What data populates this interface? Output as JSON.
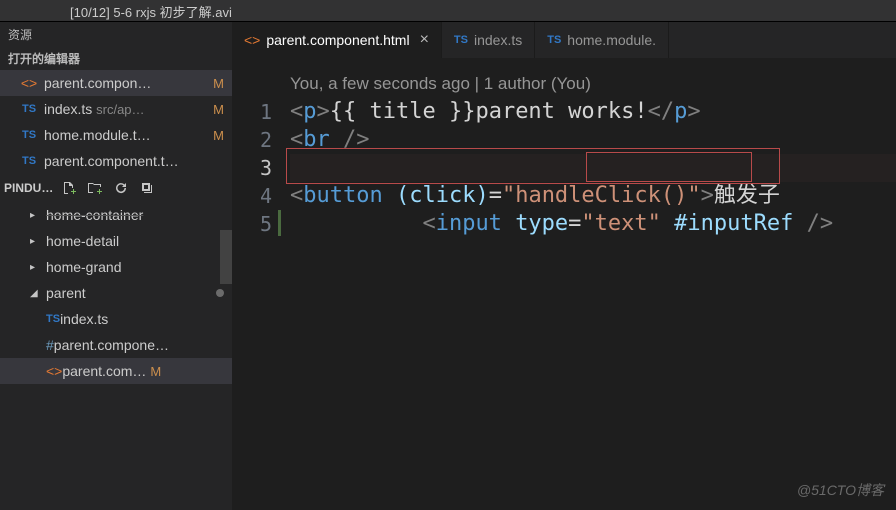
{
  "title": "[10/12] 5-6 rxjs 初步了解.avi",
  "sidebar": {
    "resources_label": "资源",
    "open_editors_label": "打开的编辑器",
    "editors": [
      {
        "icon": "<>",
        "iconClass": "orange",
        "name": "parent.compon…",
        "git": "M",
        "selected": true
      },
      {
        "icon": "TS",
        "iconClass": "ts",
        "name": "index.ts",
        "suffix": "src/ap…",
        "git": "M"
      },
      {
        "icon": "TS",
        "iconClass": "ts",
        "name": "home.module.t…",
        "git": "M"
      },
      {
        "icon": "TS",
        "iconClass": "ts",
        "name": "parent.component.t…"
      }
    ],
    "folder_label": "PINDU…",
    "tree": [
      {
        "label": "home-container",
        "expand": "▸",
        "strike": true
      },
      {
        "label": "home-detail",
        "expand": "▸"
      },
      {
        "label": "home-grand",
        "expand": "▸"
      },
      {
        "label": "parent",
        "expand": "◢",
        "dot": true,
        "open": true
      },
      {
        "icon": "TS",
        "iconClass": "ts",
        "label": "index.ts",
        "depth2": true
      },
      {
        "icon": "#",
        "iconClass": "hash",
        "label": "parent.compone…",
        "depth2": true
      },
      {
        "icon": "<>",
        "iconClass": "orange",
        "label": "parent.com…",
        "depth2": true,
        "git": "M",
        "selected": true
      }
    ]
  },
  "tabs": [
    {
      "icon": "<>",
      "iconClass": "orange",
      "label": "parent.component.html",
      "active": true,
      "closable": true
    },
    {
      "icon": "TS",
      "iconClass": "ts",
      "label": "index.ts"
    },
    {
      "icon": "TS",
      "iconClass": "ts",
      "label": "home.module."
    }
  ],
  "editor": {
    "annotation": "You, a few seconds ago | 1 author (You)",
    "lines": [
      "1",
      "2",
      "3",
      "4",
      "5"
    ],
    "current_line": "3",
    "code": {
      "l1": {
        "p_open": "<",
        "p": "p",
        "p_close": ">",
        "tmpl": "{{ title }}",
        "text": "parent works!",
        "cp_open": "</",
        "cp_close": ">"
      },
      "l2": {
        "br_open": "<",
        "br": "br",
        "br_close": " />"
      },
      "l3": {
        "in_open": "<",
        "in": "input",
        "sp1": " ",
        "attr": "type",
        "eq": "=",
        "val": "\"text\"",
        "sp2": " ",
        "ref": "#inputRef",
        "sp3": " ",
        "in_close": "/>"
      },
      "l4": {
        "b_open": "<",
        "b": "button",
        "sp1": " ",
        "attr": "(click)",
        "eq": "=",
        "val": "\"handleClick()\"",
        "b_gt": ">",
        "text": "触发子"
      }
    }
  },
  "watermark": "@51CTO博客"
}
